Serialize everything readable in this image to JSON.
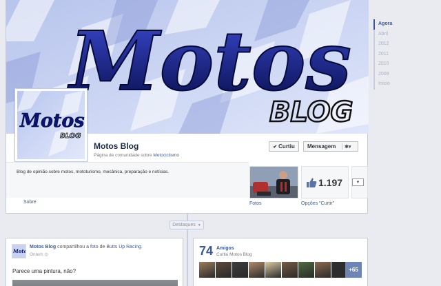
{
  "timeline_nav": [
    "Agora",
    "Abril",
    "2012",
    "2011",
    "2010",
    "2009",
    "Início"
  ],
  "cover": {
    "logo_main": "Motos",
    "logo_sub": "BLOG"
  },
  "profile": {
    "name": "Motos Blog",
    "subtitle_prefix": "Página de comunidade sobre",
    "category": "Motociclismo",
    "about_text": "Blog de opinião sobre motos, mototurismo, mecânica, preparação e notícias.",
    "about_link": "Sobre"
  },
  "actions": {
    "liked_label": "Curtiu",
    "message_label": "Mensagem"
  },
  "apps": {
    "photos_label": "Fotos",
    "likes_count": "1.197",
    "likes_label": "Opções \"Curtir\""
  },
  "highlights_label": "Destaques",
  "post": {
    "author": "Motos Blog",
    "action_text": "compartilhou a",
    "object_link": "foto",
    "preposition": "de",
    "source": "Butts Up Racing.",
    "time": "Ontem",
    "message": "Parece uma pintura, não?"
  },
  "friends": {
    "count": "74",
    "title": "Amigos",
    "subtitle": "Curtiu Motos Blog",
    "more": "+65",
    "avatar_colors": [
      "#9a7b5c",
      "#5e4a3a",
      "#3c3c3c",
      "#b08a6a",
      "#d8c9a0",
      "#7a5a44",
      "#4f6a3d",
      "#8c6b50",
      "#2f2f33"
    ]
  },
  "colors": {
    "brand": "#3b5998",
    "cover_bg": "#c8d3f2",
    "logo": "#101a78"
  }
}
